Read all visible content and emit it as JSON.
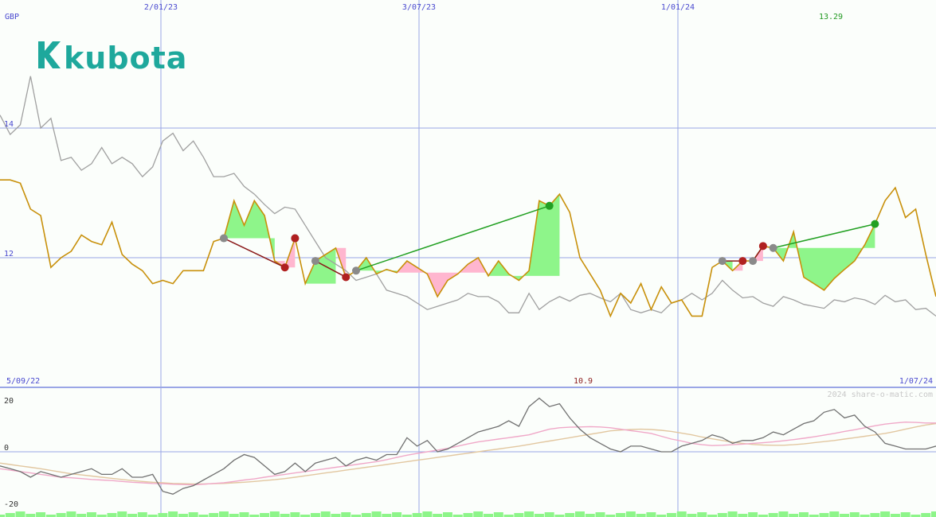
{
  "header": {
    "currency": "GBP",
    "last_price": "13.29",
    "low_price": "10.9",
    "start_date": "5/09/22",
    "end_date": "1/07/24",
    "watermark": "2024 share-o-matic.com",
    "logo_text": "kubota",
    "logo_color": "#1ea89c"
  },
  "colors": {
    "price": "#c8900a",
    "relative": "#a0a0a0",
    "grid": "#9aa6e6",
    "gain_fill": "#8ef58a",
    "loss_fill": "#ffb6cf",
    "gain_line": "#22a022",
    "loss_line": "#8b1a1a"
  },
  "chart_data": [
    {
      "type": "line",
      "title": "",
      "ylabel": "GBP",
      "ylim": [
        10,
        15.7
      ],
      "x_ticks": [
        "2/01/23",
        "3/07/23",
        "1/01/24"
      ],
      "y_ticks": [
        12,
        14
      ],
      "x": [
        0,
        1,
        2,
        3,
        4,
        5,
        6,
        7,
        8,
        9,
        10,
        11,
        12,
        13,
        14,
        15,
        16,
        17,
        18,
        19,
        20,
        21,
        22,
        23,
        24,
        25,
        26,
        27,
        28,
        29,
        30,
        31,
        32,
        33,
        34,
        35,
        36,
        37,
        38,
        39,
        40,
        41,
        42,
        43,
        44,
        45,
        46,
        47,
        48,
        49,
        50,
        51,
        52,
        53,
        54,
        55,
        56,
        57,
        58,
        59,
        60,
        61,
        62,
        63,
        64,
        65,
        66,
        67,
        68,
        69,
        70,
        71,
        72,
        73,
        74,
        75,
        76,
        77,
        78,
        79,
        80,
        81,
        82,
        83,
        84,
        85,
        86,
        87,
        88,
        89,
        90,
        91,
        92
      ],
      "series": [
        {
          "name": "",
          "values": [
            13.2,
            13.2,
            13.15,
            12.75,
            12.65,
            11.85,
            12,
            12.1,
            12.35,
            12.25,
            12.2,
            12.55,
            12.05,
            11.9,
            11.8,
            11.6,
            11.65,
            11.6,
            11.8,
            11.8,
            11.8,
            12.25,
            12.3,
            12.88,
            12.5,
            12.88,
            12.65,
            11.95,
            11.85,
            12.3,
            11.6,
            11.95,
            12.05,
            12.15,
            11.7,
            11.8,
            12,
            11.75,
            11.82,
            11.77,
            11.95,
            11.85,
            11.75,
            11.4,
            11.65,
            11.75,
            11.9,
            12,
            11.72,
            11.95,
            11.75,
            11.65,
            11.8,
            12.88,
            12.8,
            12.98,
            12.7,
            12,
            11.75,
            11.5,
            11.1,
            11.45,
            11.3,
            11.6,
            11.2,
            11.55,
            11.3,
            11.35,
            11.1,
            11.1,
            11.85,
            11.95,
            11.8,
            11.95,
            11.95,
            12.18,
            12.15,
            11.95,
            12.4,
            11.7,
            11.6,
            11.5,
            11.68,
            11.82,
            11.95,
            12.2,
            12.52,
            12.88,
            13.08,
            12.62,
            12.75,
            12.05,
            11.4
          ]
        },
        {
          "name": "",
          "values": [
            14.2,
            13.9,
            14.05,
            14.8,
            14,
            14.15,
            13.5,
            13.55,
            13.35,
            13.45,
            13.7,
            13.45,
            13.55,
            13.45,
            13.25,
            13.4,
            13.8,
            13.92,
            13.65,
            13.8,
            13.55,
            13.25,
            13.25,
            13.3,
            13.1,
            12.98,
            12.82,
            12.68,
            12.78,
            12.75,
            12.5,
            12.25,
            12,
            11.9,
            11.8,
            11.65,
            11.7,
            11.75,
            11.5,
            11.45,
            11.4,
            11.3,
            11.2,
            11.25,
            11.3,
            11.35,
            11.45,
            11.4,
            11.4,
            11.32,
            11.15,
            11.15,
            11.45,
            11.2,
            11.32,
            11.4,
            11.33,
            11.42,
            11.45,
            11.38,
            11.32,
            11.45,
            11.2,
            11.15,
            11.2,
            11.15,
            11.3,
            11.35,
            11.45,
            11.35,
            11.45,
            11.65,
            11.5,
            11.38,
            11.4,
            11.3,
            11.25,
            11.4,
            11.35,
            11.28,
            11.25,
            11.22,
            11.35,
            11.32,
            11.38,
            11.35,
            11.28,
            11.42,
            11.32,
            11.35,
            11.2,
            11.22,
            11.1
          ]
        }
      ]
    },
    {
      "type": "line",
      "title": "",
      "ylim": [
        -20,
        20
      ],
      "y_ticks": [
        -20,
        0,
        20
      ],
      "x": [
        0,
        1,
        2,
        3,
        4,
        5,
        6,
        7,
        8,
        9,
        10,
        11,
        12,
        13,
        14,
        15,
        16,
        17,
        18,
        19,
        20,
        21,
        22,
        23,
        24,
        25,
        26,
        27,
        28,
        29,
        30,
        31,
        32,
        33,
        34,
        35,
        36,
        37,
        38,
        39,
        40,
        41,
        42,
        43,
        44,
        45,
        46,
        47,
        48,
        49,
        50,
        51,
        52,
        53,
        54,
        55,
        56,
        57,
        58,
        59,
        60,
        61,
        62,
        63,
        64,
        65,
        66,
        67,
        68,
        69,
        70,
        71,
        72,
        73,
        74,
        75,
        76,
        77,
        78,
        79,
        80,
        81,
        82,
        83,
        84,
        85,
        86,
        87,
        88,
        89,
        90,
        91,
        92
      ],
      "series": [
        {
          "name": "",
          "values": [
            -5,
            -6,
            -7,
            -9,
            -7,
            -8,
            -9,
            -8,
            -7,
            -6,
            -8,
            -8,
            -6,
            -9,
            -9,
            -8,
            -14,
            -15,
            -13,
            -12,
            -10,
            -8,
            -6,
            -3,
            -1,
            -2,
            -5,
            -8,
            -7,
            -4,
            -7,
            -4,
            -3,
            -2,
            -5,
            -3,
            -2,
            -3,
            -1,
            -1,
            5,
            2,
            4,
            0,
            1,
            3,
            5,
            7,
            8,
            9,
            11,
            9,
            16,
            19,
            16,
            17,
            12,
            8,
            5,
            3,
            1,
            0,
            2,
            2,
            1,
            0,
            0,
            2,
            3,
            4,
            6,
            5,
            3,
            4,
            4,
            5,
            7,
            6,
            8,
            10,
            11,
            14,
            15,
            12,
            13,
            9,
            7,
            3,
            2,
            1,
            1,
            1,
            2
          ]
        },
        {
          "name": "",
          "values": [
            -6,
            -6.5,
            -7,
            -7.5,
            -8,
            -8.5,
            -9,
            -9.2,
            -9.5,
            -9.8,
            -10,
            -10.2,
            -10.5,
            -10.8,
            -11,
            -11.2,
            -11.3,
            -11.5,
            -11.6,
            -11.7,
            -11.5,
            -11.2,
            -11,
            -10.5,
            -10,
            -9.6,
            -9,
            -8.5,
            -8,
            -7.5,
            -7,
            -6.5,
            -6,
            -5.5,
            -5,
            -4.5,
            -4,
            -3.5,
            -2.8,
            -2,
            -1.2,
            -0.6,
            0,
            0.6,
            1.2,
            2,
            2.8,
            3.5,
            4,
            4.5,
            5,
            5.5,
            6,
            7,
            8,
            8.5,
            8.7,
            8.8,
            8.9,
            8.8,
            8.5,
            8,
            7.5,
            7,
            6.5,
            5.5,
            4.5,
            3.8,
            3,
            2.5,
            2.2,
            2.3,
            2.5,
            2.7,
            3,
            3.2,
            3.5,
            3.9,
            4.3,
            4.8,
            5.3,
            5.9,
            6.5,
            7.2,
            7.8,
            8.5,
            9.2,
            9.8,
            10.2,
            10.5,
            10.4,
            10.2,
            10.2
          ]
        },
        {
          "name": "",
          "values": [
            -4,
            -4.5,
            -5,
            -5.5,
            -6,
            -6.6,
            -7.2,
            -7.8,
            -8.2,
            -8.6,
            -9,
            -9.4,
            -9.8,
            -10.2,
            -10.5,
            -10.8,
            -11,
            -11.2,
            -11.3,
            -11.4,
            -11.4,
            -11.3,
            -11.2,
            -11,
            -10.8,
            -10.5,
            -10.2,
            -9.9,
            -9.5,
            -9,
            -8.5,
            -8,
            -7.5,
            -7,
            -6.5,
            -6,
            -5.5,
            -5,
            -4.5,
            -4,
            -3.5,
            -3,
            -2.5,
            -2,
            -1.5,
            -1,
            -0.5,
            0,
            0.5,
            1,
            1.5,
            2,
            2.6,
            3.2,
            3.8,
            4.4,
            5,
            5.6,
            6.2,
            6.8,
            7.4,
            7.7,
            7.9,
            8,
            7.9,
            7.6,
            7.2,
            6.6,
            6,
            5.2,
            4.6,
            4,
            3.4,
            3,
            2.6,
            2.4,
            2.3,
            2.3,
            2.5,
            2.8,
            3.2,
            3.6,
            4,
            4.5,
            5,
            5.5,
            6,
            6.5,
            7.2,
            8,
            8.8,
            9.5,
            10
          ]
        }
      ]
    }
  ]
}
